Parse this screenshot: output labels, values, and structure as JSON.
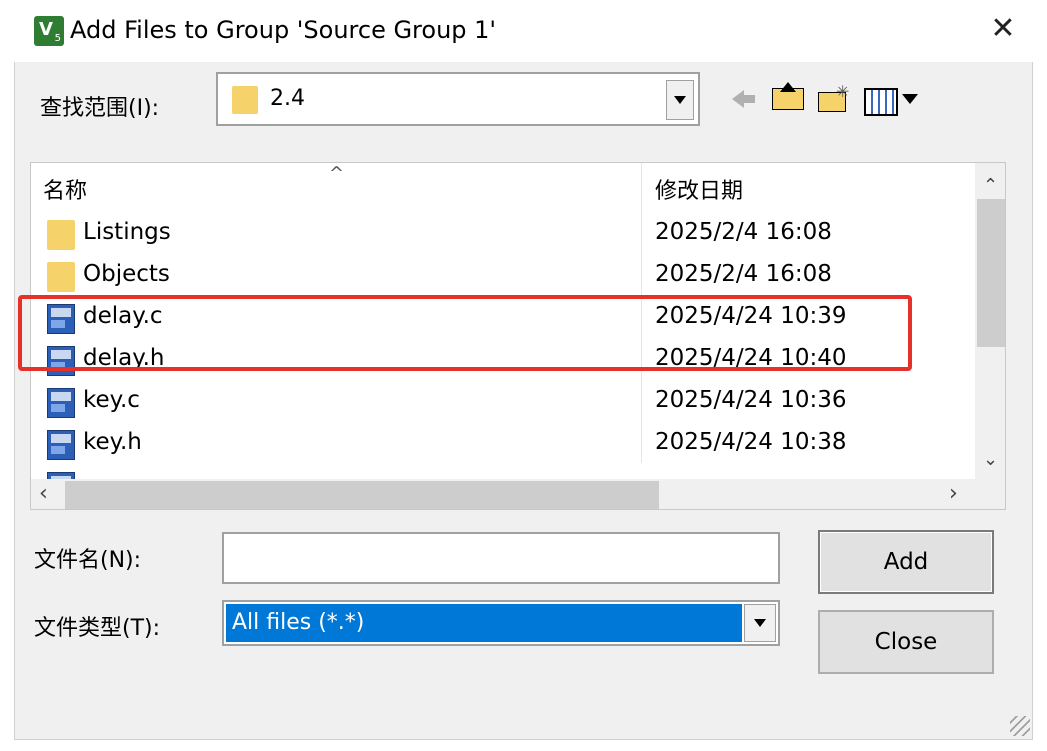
{
  "window": {
    "title": "Add Files to Group 'Source Group 1'",
    "close_glyph": "✕",
    "app_icon_letter": "V",
    "app_icon_sub": "5"
  },
  "lookin": {
    "label": "查找范围(I):",
    "value": "2.4"
  },
  "toolbar": {
    "back": "back-arrow-icon",
    "up": "up-folder-icon",
    "new_folder": "new-folder-icon",
    "view": "view-menu-icon"
  },
  "list": {
    "columns": {
      "name": "名称",
      "date": "修改日期"
    },
    "sort_indicator": "^",
    "rows": [
      {
        "name": "Listings",
        "date": "2025/2/4 16:08",
        "type": "folder"
      },
      {
        "name": "Objects",
        "date": "2025/2/4 16:08",
        "type": "folder"
      },
      {
        "name": "delay.c",
        "date": "2025/4/24 10:39",
        "type": "file"
      },
      {
        "name": "delay.h",
        "date": "2025/4/24 10:40",
        "type": "file"
      },
      {
        "name": "key.c",
        "date": "2025/4/24 10:36",
        "type": "file"
      },
      {
        "name": "key.h",
        "date": "2025/4/24 10:38",
        "type": "file"
      }
    ]
  },
  "filename": {
    "label": "文件名(N):",
    "value": ""
  },
  "filetype": {
    "label": "文件类型(T):",
    "value": "All files (*.*)"
  },
  "buttons": {
    "add": "Add",
    "close": "Close"
  },
  "colors": {
    "selection": "#0078d7",
    "highlight_box": "#e8302a"
  }
}
